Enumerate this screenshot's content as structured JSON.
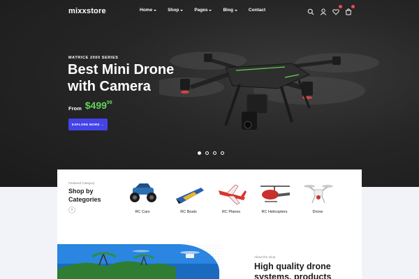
{
  "brand": {
    "logo": "mixxstore"
  },
  "nav": {
    "items": [
      {
        "label": "Home",
        "has_dropdown": true
      },
      {
        "label": "Shop",
        "has_dropdown": true
      },
      {
        "label": "Pages",
        "has_dropdown": true
      },
      {
        "label": "Blog",
        "has_dropdown": true
      },
      {
        "label": "Contact",
        "has_dropdown": false
      }
    ],
    "icons": [
      "search-icon",
      "user-icon",
      "heart-icon",
      "cart-icon"
    ]
  },
  "hero": {
    "series": "MATRICE 2000 SERIES",
    "headline_line1": "Best Mini Drone",
    "headline_line2": "with Camera",
    "from_label": "From",
    "price": "$499",
    "price_cents": "99",
    "cta": "EXPLORE MORE →",
    "slider_count": 4,
    "slider_active": 1
  },
  "categories": {
    "small_label": "Featured Category",
    "title_line1": "Shop by",
    "title_line2": "Categories",
    "items": [
      {
        "label": "RC Cars"
      },
      {
        "label": "RC Boats"
      },
      {
        "label": "RC Planes"
      },
      {
        "label": "RC Helicopters"
      },
      {
        "label": "Drone"
      }
    ]
  },
  "about": {
    "small_label": "About the shop",
    "title_line1": "High quality drone",
    "title_line2": "systems, products"
  },
  "colors": {
    "accent": "#4343e8",
    "price": "#5fd35a",
    "hero_bg": "#262626",
    "badge": "#e84b5a"
  }
}
